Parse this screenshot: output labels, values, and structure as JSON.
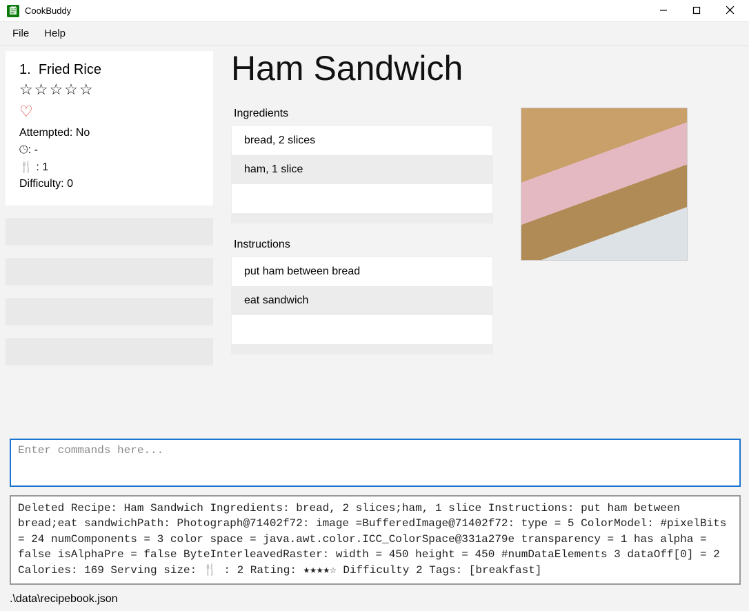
{
  "app": {
    "title": "CookBuddy"
  },
  "menu": {
    "file": "File",
    "help": "Help"
  },
  "sidebar": {
    "recipe": {
      "index": "1.",
      "name": "Fried Rice",
      "stars": "☆☆☆☆☆",
      "heart": "♡",
      "attempted_label": "Attempted:",
      "attempted_value": "No",
      "time_label": "🕒︎:",
      "time_value": "-",
      "serving_label": "🍴 :",
      "serving_value": "1",
      "difficulty_label": "Difficulty:",
      "difficulty_value": "0"
    }
  },
  "detail": {
    "title": "Ham Sandwich",
    "ingredients_label": "Ingredients",
    "ingredients": [
      "bread, 2 slices",
      "ham, 1 slice"
    ],
    "instructions_label": "Instructions",
    "instructions": [
      "put ham between bread",
      "eat sandwich"
    ]
  },
  "command": {
    "placeholder": "Enter commands here..."
  },
  "output": {
    "text": "Deleted Recipe: Ham Sandwich Ingredients: bread, 2 slices;ham, 1 slice Instructions: put ham between bread;eat sandwichPath: Photograph@71402f72: image =BufferedImage@71402f72: type = 5 ColorModel: #pixelBits = 24 numComponents = 3 color space = java.awt.color.ICC_ColorSpace@331a279e transparency = 1 has alpha = false isAlphaPre = false ByteInterleavedRaster: width = 450 height = 450 #numDataElements 3 dataOff[0] = 2 Calories: 169 Serving size: 🍴 : 2 Rating: ★★★★☆ Difficulty 2 Tags: [breakfast]"
  },
  "status": {
    "path": ".\\data\\recipebook.json"
  }
}
